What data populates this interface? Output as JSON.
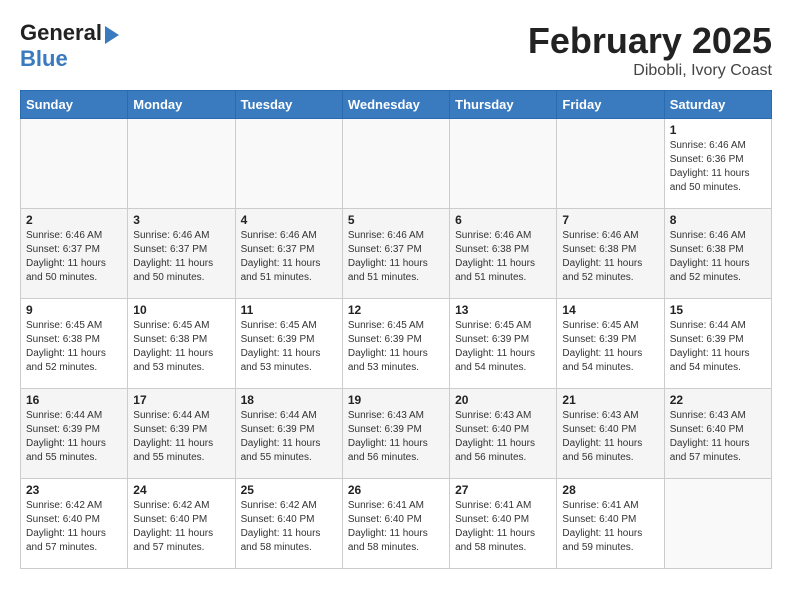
{
  "header": {
    "logo_line1": "General",
    "logo_line2": "Blue",
    "month": "February 2025",
    "location": "Dibobli, Ivory Coast"
  },
  "weekdays": [
    "Sunday",
    "Monday",
    "Tuesday",
    "Wednesday",
    "Thursday",
    "Friday",
    "Saturday"
  ],
  "weeks": [
    [
      {
        "day": "",
        "info": ""
      },
      {
        "day": "",
        "info": ""
      },
      {
        "day": "",
        "info": ""
      },
      {
        "day": "",
        "info": ""
      },
      {
        "day": "",
        "info": ""
      },
      {
        "day": "",
        "info": ""
      },
      {
        "day": "1",
        "info": "Sunrise: 6:46 AM\nSunset: 6:36 PM\nDaylight: 11 hours and 50 minutes."
      }
    ],
    [
      {
        "day": "2",
        "info": "Sunrise: 6:46 AM\nSunset: 6:37 PM\nDaylight: 11 hours and 50 minutes."
      },
      {
        "day": "3",
        "info": "Sunrise: 6:46 AM\nSunset: 6:37 PM\nDaylight: 11 hours and 50 minutes."
      },
      {
        "day": "4",
        "info": "Sunrise: 6:46 AM\nSunset: 6:37 PM\nDaylight: 11 hours and 51 minutes."
      },
      {
        "day": "5",
        "info": "Sunrise: 6:46 AM\nSunset: 6:37 PM\nDaylight: 11 hours and 51 minutes."
      },
      {
        "day": "6",
        "info": "Sunrise: 6:46 AM\nSunset: 6:38 PM\nDaylight: 11 hours and 51 minutes."
      },
      {
        "day": "7",
        "info": "Sunrise: 6:46 AM\nSunset: 6:38 PM\nDaylight: 11 hours and 52 minutes."
      },
      {
        "day": "8",
        "info": "Sunrise: 6:46 AM\nSunset: 6:38 PM\nDaylight: 11 hours and 52 minutes."
      }
    ],
    [
      {
        "day": "9",
        "info": "Sunrise: 6:45 AM\nSunset: 6:38 PM\nDaylight: 11 hours and 52 minutes."
      },
      {
        "day": "10",
        "info": "Sunrise: 6:45 AM\nSunset: 6:38 PM\nDaylight: 11 hours and 53 minutes."
      },
      {
        "day": "11",
        "info": "Sunrise: 6:45 AM\nSunset: 6:39 PM\nDaylight: 11 hours and 53 minutes."
      },
      {
        "day": "12",
        "info": "Sunrise: 6:45 AM\nSunset: 6:39 PM\nDaylight: 11 hours and 53 minutes."
      },
      {
        "day": "13",
        "info": "Sunrise: 6:45 AM\nSunset: 6:39 PM\nDaylight: 11 hours and 54 minutes."
      },
      {
        "day": "14",
        "info": "Sunrise: 6:45 AM\nSunset: 6:39 PM\nDaylight: 11 hours and 54 minutes."
      },
      {
        "day": "15",
        "info": "Sunrise: 6:44 AM\nSunset: 6:39 PM\nDaylight: 11 hours and 54 minutes."
      }
    ],
    [
      {
        "day": "16",
        "info": "Sunrise: 6:44 AM\nSunset: 6:39 PM\nDaylight: 11 hours and 55 minutes."
      },
      {
        "day": "17",
        "info": "Sunrise: 6:44 AM\nSunset: 6:39 PM\nDaylight: 11 hours and 55 minutes."
      },
      {
        "day": "18",
        "info": "Sunrise: 6:44 AM\nSunset: 6:39 PM\nDaylight: 11 hours and 55 minutes."
      },
      {
        "day": "19",
        "info": "Sunrise: 6:43 AM\nSunset: 6:39 PM\nDaylight: 11 hours and 56 minutes."
      },
      {
        "day": "20",
        "info": "Sunrise: 6:43 AM\nSunset: 6:40 PM\nDaylight: 11 hours and 56 minutes."
      },
      {
        "day": "21",
        "info": "Sunrise: 6:43 AM\nSunset: 6:40 PM\nDaylight: 11 hours and 56 minutes."
      },
      {
        "day": "22",
        "info": "Sunrise: 6:43 AM\nSunset: 6:40 PM\nDaylight: 11 hours and 57 minutes."
      }
    ],
    [
      {
        "day": "23",
        "info": "Sunrise: 6:42 AM\nSunset: 6:40 PM\nDaylight: 11 hours and 57 minutes."
      },
      {
        "day": "24",
        "info": "Sunrise: 6:42 AM\nSunset: 6:40 PM\nDaylight: 11 hours and 57 minutes."
      },
      {
        "day": "25",
        "info": "Sunrise: 6:42 AM\nSunset: 6:40 PM\nDaylight: 11 hours and 58 minutes."
      },
      {
        "day": "26",
        "info": "Sunrise: 6:41 AM\nSunset: 6:40 PM\nDaylight: 11 hours and 58 minutes."
      },
      {
        "day": "27",
        "info": "Sunrise: 6:41 AM\nSunset: 6:40 PM\nDaylight: 11 hours and 58 minutes."
      },
      {
        "day": "28",
        "info": "Sunrise: 6:41 AM\nSunset: 6:40 PM\nDaylight: 11 hours and 59 minutes."
      },
      {
        "day": "",
        "info": ""
      }
    ]
  ]
}
